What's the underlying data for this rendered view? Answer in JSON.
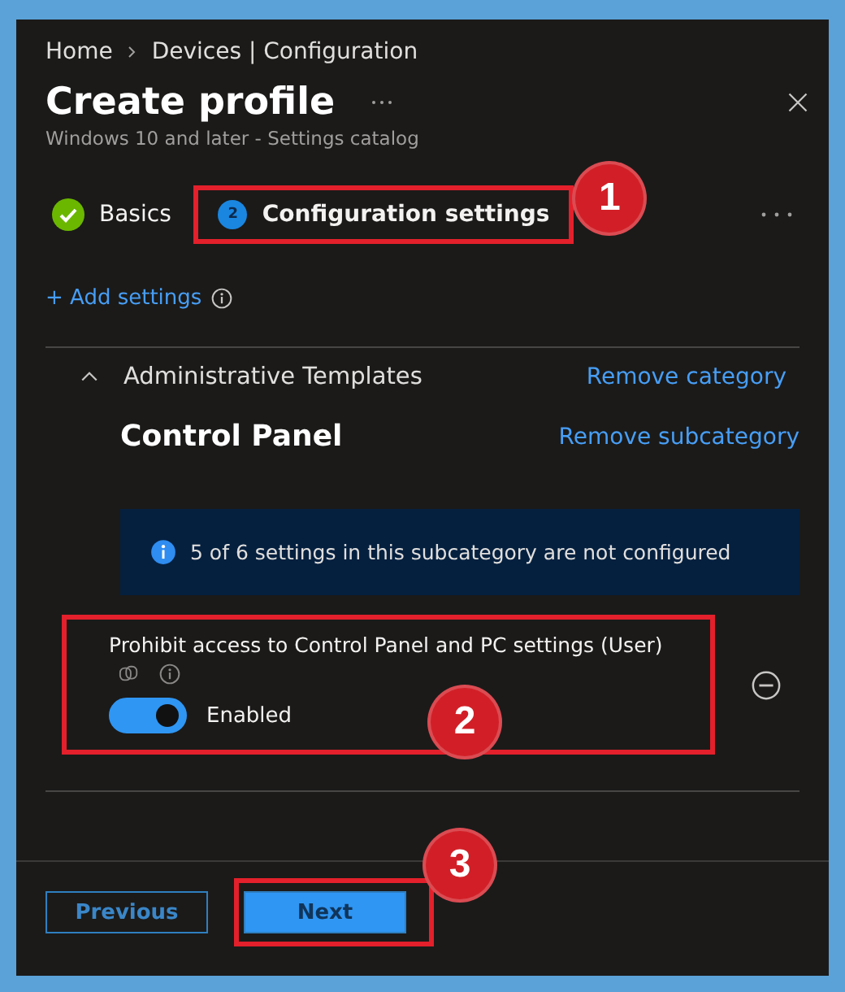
{
  "breadcrumb": [
    {
      "label": "Home"
    },
    {
      "label": "Devices | Configuration"
    }
  ],
  "title": "Create profile",
  "subtitle": "Windows 10 and later - Settings catalog",
  "steps": [
    {
      "label": "Basics",
      "completed": true,
      "selected": false
    },
    {
      "label": "Configuration settings",
      "completed": false,
      "number": "2",
      "selected": true,
      "callout": "1"
    }
  ],
  "add_settings": "+ Add settings",
  "category": {
    "title": "Administrative Templates",
    "expanded": true,
    "remove": "Remove category"
  },
  "subcategory": {
    "title": "Control Panel",
    "remove": "Remove subcategory"
  },
  "info": "5 of 6 settings in this subcategory are not configured",
  "settings": [
    {
      "label": "Prohibit access to Control Panel and PC settings (User)",
      "on": true,
      "value": "Enabled",
      "callout": "2"
    }
  ],
  "buttons": [
    {
      "label": "Previous",
      "kind": "secondary"
    },
    {
      "label": "Next",
      "kind": "primary",
      "callout": "3"
    }
  ]
}
